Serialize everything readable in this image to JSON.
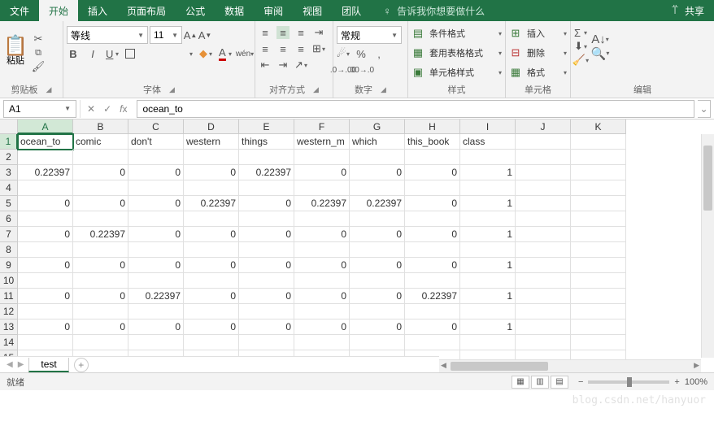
{
  "tabs": [
    "文件",
    "开始",
    "插入",
    "页面布局",
    "公式",
    "数据",
    "审阅",
    "视图",
    "团队"
  ],
  "active_tab_index": 1,
  "tell_me": "告诉我你想要做什么",
  "share": "共享",
  "ribbon": {
    "clipboard": {
      "label": "剪贴板",
      "paste": "粘贴"
    },
    "font": {
      "label": "字体",
      "name": "等线",
      "size": "11"
    },
    "align": {
      "label": "对齐方式"
    },
    "number": {
      "label": "数字",
      "format": "常规"
    },
    "styles": {
      "label": "样式",
      "cond": "条件格式",
      "table": "套用表格格式",
      "cell": "单元格样式"
    },
    "cells": {
      "label": "单元格",
      "insert": "插入",
      "delete": "删除",
      "format": "格式"
    },
    "editing": {
      "label": "编辑"
    }
  },
  "formula": {
    "name_box": "A1",
    "value": "ocean_to"
  },
  "columns": [
    "A",
    "B",
    "C",
    "D",
    "E",
    "F",
    "G",
    "H",
    "I",
    "J",
    "K"
  ],
  "headers": [
    "ocean_to",
    "comic",
    "don't",
    "western",
    "things",
    "western_m",
    "which",
    "this_book",
    "class"
  ],
  "data_rows": [
    {
      "r": 3,
      "v": [
        "0.22397",
        "0",
        "0",
        "0",
        "0.22397",
        "0",
        "0",
        "0",
        "1"
      ]
    },
    {
      "r": 5,
      "v": [
        "0",
        "0",
        "0",
        "0.22397",
        "0",
        "0.22397",
        "0.22397",
        "0",
        "1"
      ]
    },
    {
      "r": 7,
      "v": [
        "0",
        "0.22397",
        "0",
        "0",
        "0",
        "0",
        "0",
        "0",
        "1"
      ]
    },
    {
      "r": 9,
      "v": [
        "0",
        "0",
        "0",
        "0",
        "0",
        "0",
        "0",
        "0",
        "1"
      ]
    },
    {
      "r": 11,
      "v": [
        "0",
        "0",
        "0.22397",
        "0",
        "0",
        "0",
        "0",
        "0.22397",
        "1"
      ]
    },
    {
      "r": 13,
      "v": [
        "0",
        "0",
        "0",
        "0",
        "0",
        "0",
        "0",
        "0",
        "1"
      ]
    }
  ],
  "row_count": 15,
  "sheet": {
    "active": "test"
  },
  "status": {
    "ready": "就绪",
    "zoom": "100%"
  },
  "watermark": "blog.csdn.net/hanyuor"
}
